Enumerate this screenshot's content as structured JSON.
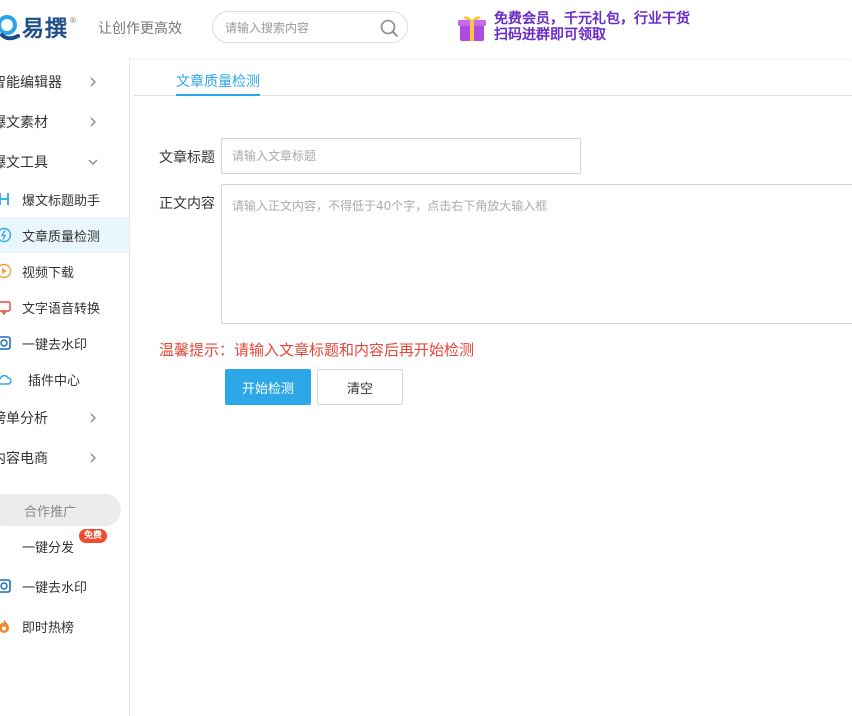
{
  "header": {
    "logo_text": "易撰",
    "logo_reg": "®",
    "slogan": "让创作更高效",
    "search_placeholder": "请输入搜索内容",
    "banner_line1": "免费会员，千元礼包，行业干货",
    "banner_line2": "扫码进群即可领取"
  },
  "sidebar": {
    "groups": {
      "smart_editor": "智能编辑器",
      "material": "爆文素材",
      "tools": "爆文工具",
      "ranking": "榜单分析",
      "ecommerce": "内容电商"
    },
    "tool_items": [
      "爆文标题助手",
      "文章质量检测",
      "视频下载",
      "文字语音转换",
      "一键去水印",
      "插件中心"
    ],
    "promo_title": "合作推广",
    "promo_items": [
      "一键分发",
      "一键去水印",
      "即时热榜"
    ],
    "free_badge": "免费"
  },
  "main": {
    "tab_label": "文章质量检测",
    "title_label": "文章标题",
    "title_placeholder": "请输入文章标题",
    "content_label": "正文内容",
    "content_placeholder": "请输入正文内容，不得低于40个字，点击右下角放大输入框",
    "tip": "温馨提示：请输入文章标题和内容后再开始检测",
    "start_button": "开始检测",
    "clear_button": "清空"
  },
  "colors": {
    "accent": "#2ca8e8",
    "tip_red": "#e5483a",
    "badge_red": "#f24a2b",
    "active_bg": "#eaf6fd"
  }
}
